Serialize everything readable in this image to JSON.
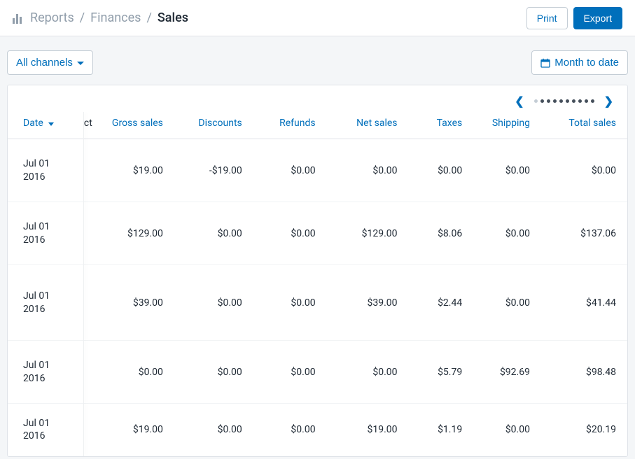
{
  "header": {
    "breadcrumb": {
      "reports": "Reports",
      "finances": "Finances",
      "current": "Sales"
    },
    "print": "Print",
    "export": "Export"
  },
  "toolbar": {
    "channels": "All channels",
    "dateRange": "Month to date"
  },
  "columns": {
    "date": "Date",
    "fragment": "ct",
    "gross": "Gross sales",
    "discounts": "Discounts",
    "refunds": "Refunds",
    "net": "Net sales",
    "taxes": "Taxes",
    "shipping": "Shipping",
    "total": "Total sales"
  },
  "rows": [
    {
      "date_l1": "Jul 01",
      "date_l2": "2016",
      "gross": "$19.00",
      "discounts": "-$19.00",
      "refunds": "$0.00",
      "net": "$0.00",
      "taxes": "$0.00",
      "shipping": "$0.00",
      "total": "$0.00"
    },
    {
      "date_l1": "Jul 01",
      "date_l2": "2016",
      "gross": "$129.00",
      "discounts": "$0.00",
      "refunds": "$0.00",
      "net": "$129.00",
      "taxes": "$8.06",
      "shipping": "$0.00",
      "total": "$137.06"
    },
    {
      "date_l1": "Jul 01",
      "date_l2": "2016",
      "gross": "$39.00",
      "discounts": "$0.00",
      "refunds": "$0.00",
      "net": "$39.00",
      "taxes": "$2.44",
      "shipping": "$0.00",
      "total": "$41.44"
    },
    {
      "date_l1": "Jul 01",
      "date_l2": "2016",
      "gross": "$0.00",
      "discounts": "$0.00",
      "refunds": "$0.00",
      "net": "$0.00",
      "taxes": "$5.79",
      "shipping": "$92.69",
      "total": "$98.48"
    },
    {
      "date_l1": "Jul 01",
      "date_l2": "2016",
      "gross": "$19.00",
      "discounts": "$0.00",
      "refunds": "$0.00",
      "net": "$19.00",
      "taxes": "$1.19",
      "shipping": "$0.00",
      "total": "$20.19"
    }
  ],
  "pager": {
    "pages": 10,
    "activeIndex": 0
  }
}
